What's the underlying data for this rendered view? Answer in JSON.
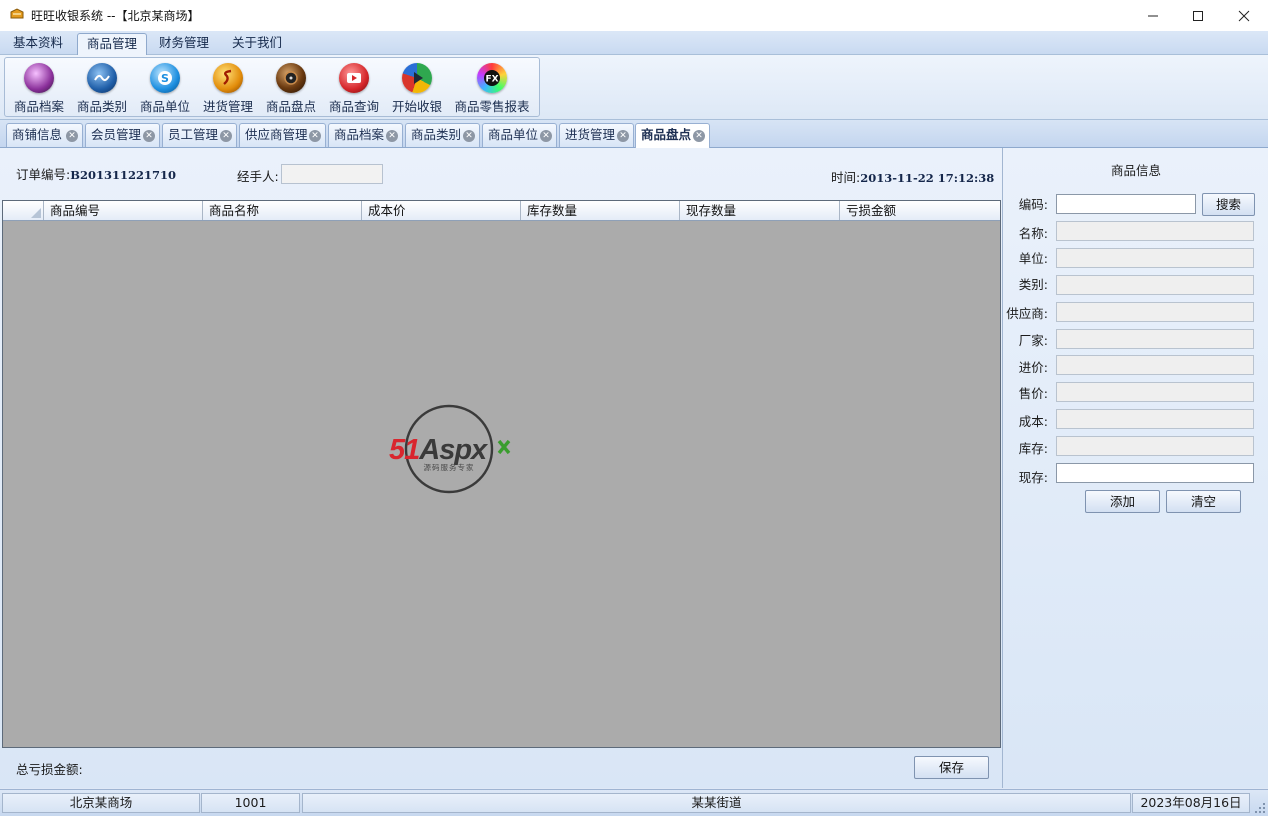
{
  "window": {
    "title": "旺旺收银系统 --【北京某商场】"
  },
  "menu": [
    {
      "label": "基本资料",
      "active": false
    },
    {
      "label": "商品管理",
      "active": true
    },
    {
      "label": "财务管理",
      "active": false
    },
    {
      "label": "关于我们",
      "active": false
    }
  ],
  "ribbon": [
    {
      "label": "商品档案",
      "icon": "product-archive-icon"
    },
    {
      "label": "商品类别",
      "icon": "product-category-icon"
    },
    {
      "label": "商品单位",
      "icon": "product-unit-icon"
    },
    {
      "label": "进货管理",
      "icon": "purchase-icon"
    },
    {
      "label": "商品盘点",
      "icon": "inventory-check-icon"
    },
    {
      "label": "商品查询",
      "icon": "product-query-icon"
    },
    {
      "label": "开始收银",
      "icon": "start-cashier-icon"
    },
    {
      "label": "商品零售报表",
      "icon": "retail-report-icon"
    }
  ],
  "tabs": [
    {
      "label": "商铺信息",
      "active": false
    },
    {
      "label": "会员管理",
      "active": false
    },
    {
      "label": "员工管理",
      "active": false
    },
    {
      "label": "供应商管理",
      "active": false
    },
    {
      "label": "商品档案",
      "active": false
    },
    {
      "label": "商品类别",
      "active": false
    },
    {
      "label": "商品单位",
      "active": false
    },
    {
      "label": "进货管理",
      "active": false
    },
    {
      "label": "商品盘点",
      "active": true
    }
  ],
  "order": {
    "number_label": "订单编号:",
    "number": "B201311221710",
    "handler_label": "经手人:",
    "handler": "",
    "time_label": "时间:",
    "time": "2013-11-22 17:12:38"
  },
  "grid": {
    "columns": [
      "商品编号",
      "商品名称",
      "成本价",
      "库存数量",
      "现存数量",
      "亏损金额"
    ],
    "rows": []
  },
  "watermark": {
    "brand": "51Aspx",
    "tagline": "源码服务专家"
  },
  "footer": {
    "total_loss_label": "总亏损金额:",
    "total_loss": "",
    "save_label": "保存"
  },
  "product_info": {
    "title": "商品信息",
    "search_label": "搜索",
    "fields": [
      {
        "label": "编码:",
        "value": ""
      },
      {
        "label": "名称:",
        "value": ""
      },
      {
        "label": "单位:",
        "value": ""
      },
      {
        "label": "类别:",
        "value": ""
      },
      {
        "label": "供应商:",
        "value": ""
      },
      {
        "label": "厂家:",
        "value": ""
      },
      {
        "label": "进价:",
        "value": ""
      },
      {
        "label": "售价:",
        "value": ""
      },
      {
        "label": "成本:",
        "value": ""
      },
      {
        "label": "库存:",
        "value": ""
      },
      {
        "label": "现存:",
        "value": ""
      }
    ],
    "add_label": "添加",
    "clear_label": "清空"
  },
  "status": {
    "store": "北京某商场",
    "code": "1001",
    "address": "某某街道",
    "date": "2023年08月16日"
  },
  "colors": {
    "accent": "#c9daf1",
    "grid_bg": "#ababab",
    "logo_red": "#d9262e",
    "logo_green": "#3a9d2e"
  }
}
